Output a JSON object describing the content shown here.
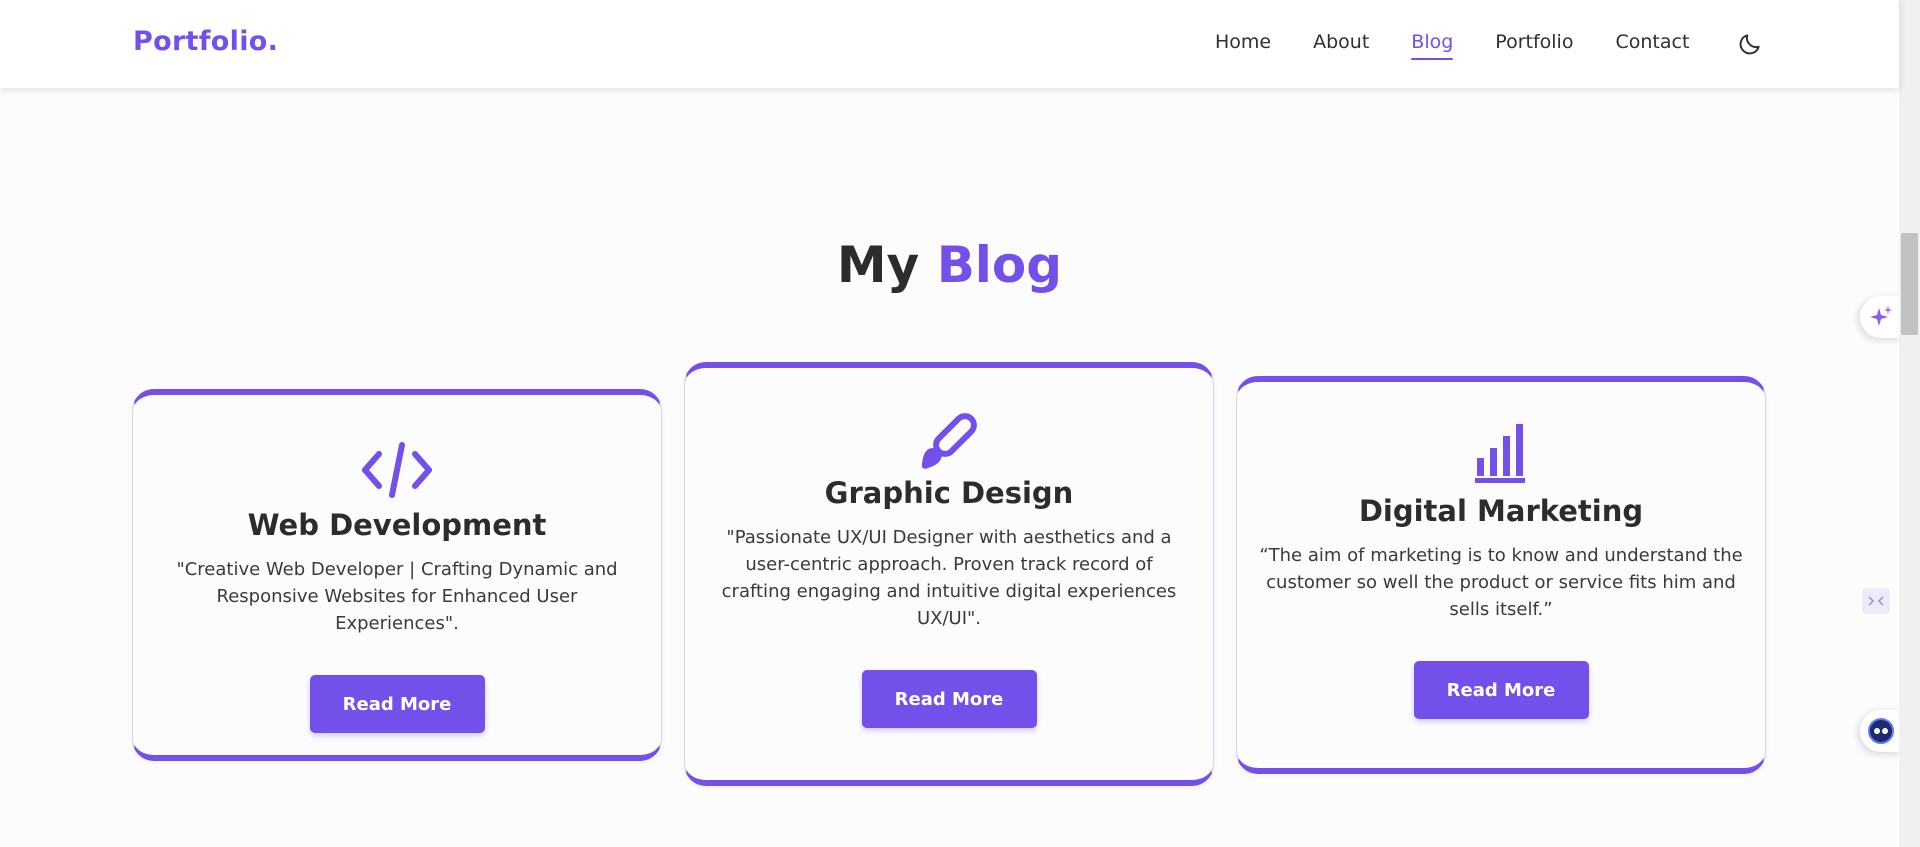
{
  "header": {
    "logo": "Portfolio.",
    "nav": [
      "Home",
      "About",
      "Blog",
      "Portfolio",
      "Contact"
    ],
    "active_nav": "Blog",
    "theme_icon": "moon-icon"
  },
  "section": {
    "title_plain": "My",
    "title_accent": "Blog"
  },
  "cards": [
    {
      "icon": "code-icon",
      "title": "Web Development",
      "lines": [
        "\"Creative Web Developer | Crafting Dynamic and",
        "Responsive Websites for Enhanced User Experiences\"."
      ],
      "button": "Read More"
    },
    {
      "icon": "paint-brush-icon",
      "title": "Graphic Design",
      "lines": [
        "\"Passionate UX/UI Designer with aesthetics and a",
        "user-centric approach. Proven track record of",
        "crafting engaging and intuitive digital experiences",
        "UX/UI\"."
      ],
      "button": "Read More"
    },
    {
      "icon": "bar-chart-icon",
      "title": "Digital Marketing",
      "lines": [
        "“The aim of marketing is to know and understand the",
        "customer so well the product or service fits him and",
        "sells itself.”"
      ],
      "button": "Read More"
    }
  ],
  "colors": {
    "accent": "#7450ea",
    "text": "#2c2c2c",
    "background": "#fdfcfd"
  }
}
